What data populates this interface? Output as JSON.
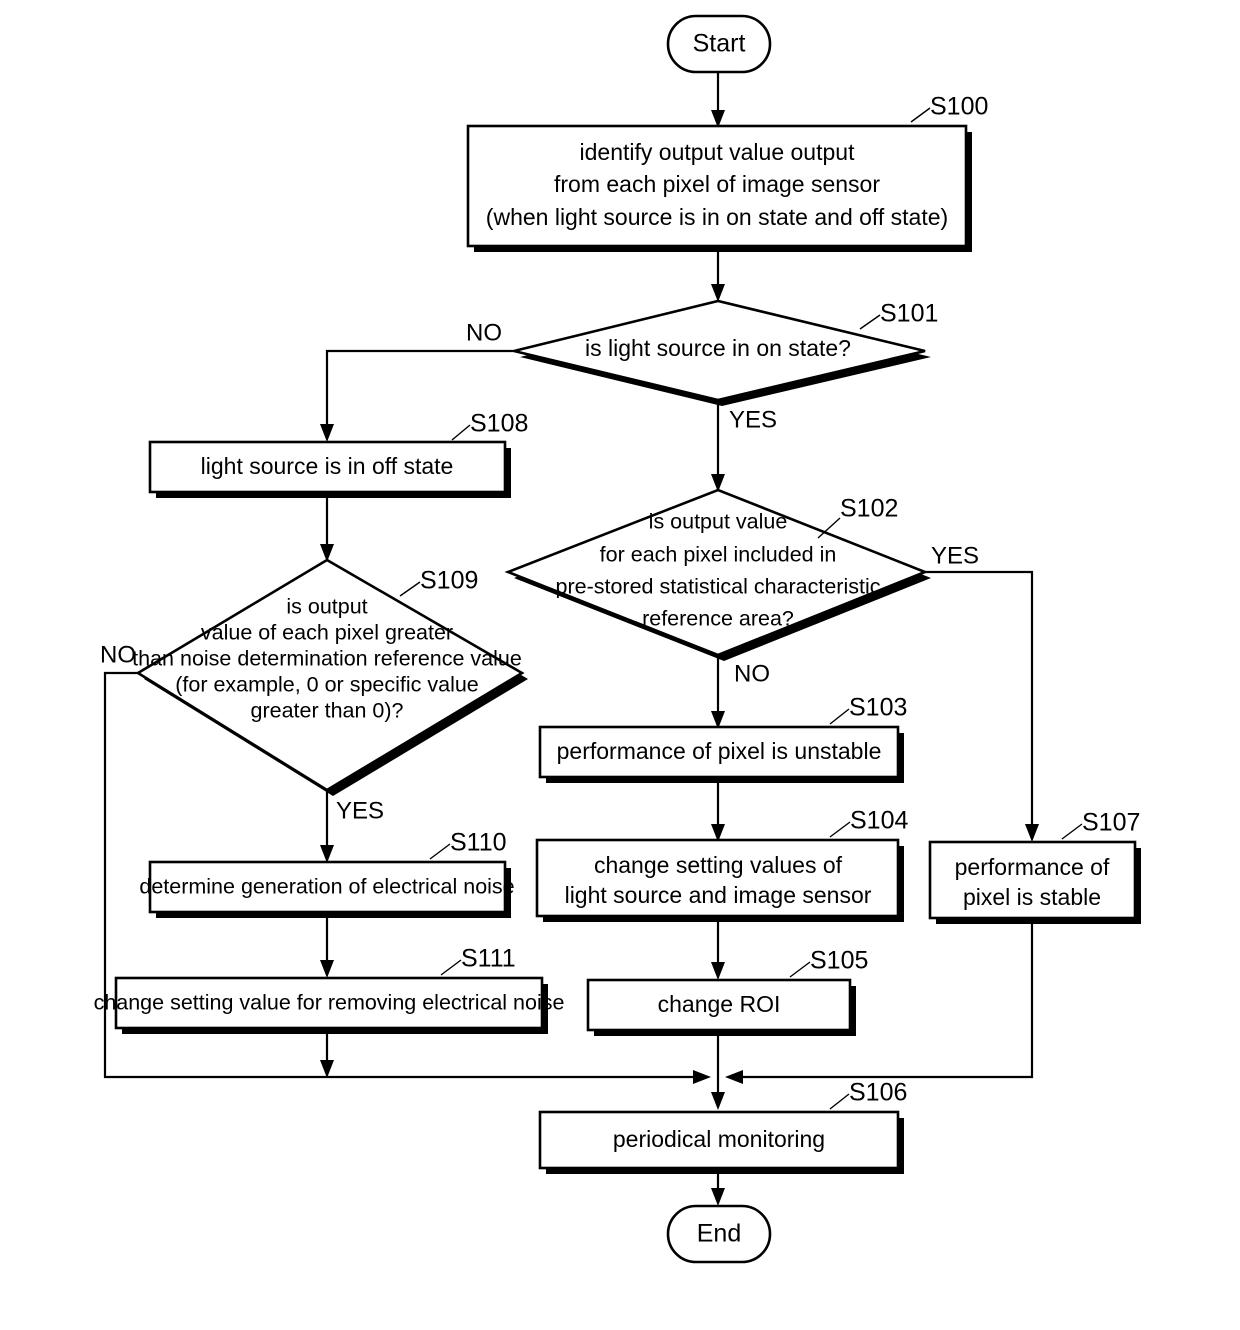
{
  "diagram": {
    "type": "flowchart",
    "title": "",
    "terminators": {
      "start": "Start",
      "end": "End"
    },
    "branch_labels": {
      "s101_no": "NO",
      "s101_yes": "YES",
      "s102_yes": "YES",
      "s102_no": "NO",
      "s109_no": "NO",
      "s109_yes": "YES"
    },
    "nodes": [
      {
        "ref": "S100",
        "shape": "process",
        "lines": [
          "identify output value output",
          "from each pixel of image sensor",
          "(when light source is in on state and off state)"
        ]
      },
      {
        "ref": "S101",
        "shape": "decision",
        "lines": [
          "is light source in on state?"
        ]
      },
      {
        "ref": "S102",
        "shape": "decision",
        "lines": [
          "is output value",
          "for each pixel included in",
          "pre-stored statistical characteristic",
          "reference area?"
        ]
      },
      {
        "ref": "S103",
        "shape": "process",
        "lines": [
          "performance of pixel is unstable"
        ]
      },
      {
        "ref": "S104",
        "shape": "process",
        "lines": [
          "change setting values of",
          "light source and image sensor"
        ]
      },
      {
        "ref": "S105",
        "shape": "process",
        "lines": [
          "change ROI"
        ]
      },
      {
        "ref": "S106",
        "shape": "process",
        "lines": [
          "periodical monitoring"
        ]
      },
      {
        "ref": "S107",
        "shape": "process",
        "lines": [
          "performance of",
          "pixel is stable"
        ]
      },
      {
        "ref": "S108",
        "shape": "process",
        "lines": [
          "light source is in off state"
        ]
      },
      {
        "ref": "S109",
        "shape": "decision",
        "lines": [
          "is output",
          "value of each pixel greater",
          "than noise determination reference value",
          "(for example, 0 or specific value",
          "greater than 0)?"
        ]
      },
      {
        "ref": "S110",
        "shape": "process",
        "lines": [
          "determine generation of electrical noise"
        ]
      },
      {
        "ref": "S111",
        "shape": "process",
        "lines": [
          "change setting value for removing electrical noise"
        ]
      }
    ],
    "colors": {
      "line": "#000000",
      "fill": "#ffffff",
      "background": "#ffffff"
    }
  }
}
